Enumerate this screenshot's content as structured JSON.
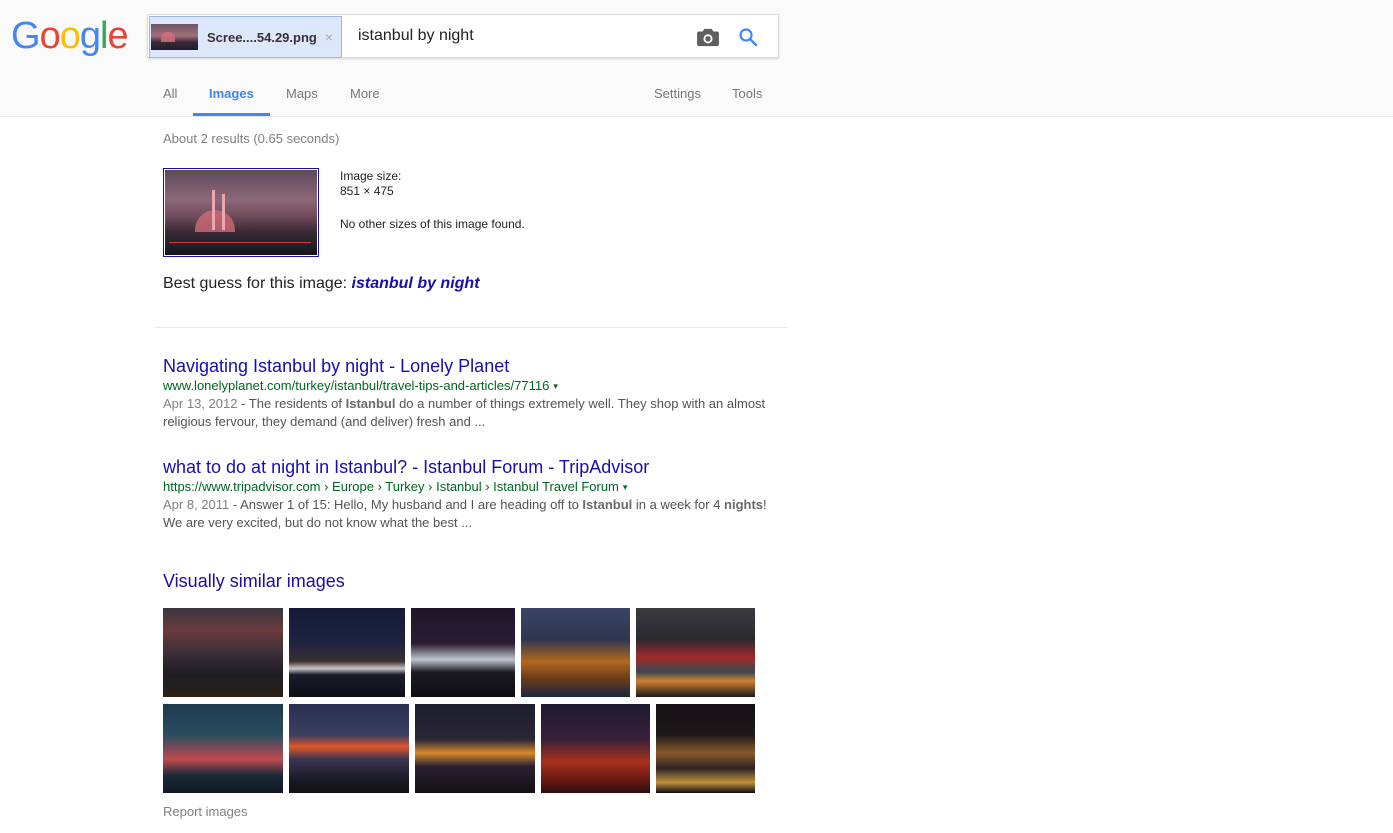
{
  "logo": {
    "letters": [
      "G",
      "o",
      "o",
      "g",
      "l",
      "e"
    ],
    "colors": [
      "#4285f4",
      "#ea4335",
      "#fbbc05",
      "#4285f4",
      "#34a853",
      "#ea4335"
    ]
  },
  "search": {
    "image_chip": {
      "filename": "Scree....54.29.png",
      "close_glyph": "×"
    },
    "query": "istanbul by night",
    "camera_icon": "camera-icon",
    "search_icon": "search-icon"
  },
  "tabs": [
    {
      "label": "All",
      "active": false
    },
    {
      "label": "Images",
      "active": true
    },
    {
      "label": "Maps",
      "active": false
    },
    {
      "label": "More",
      "active": false
    },
    {
      "label": "Settings",
      "active": false
    },
    {
      "label": "Tools",
      "active": false
    }
  ],
  "stats": "About 2 results (0.65 seconds)",
  "query_image": {
    "size_label": "Image size:",
    "size_value": "851 × 475",
    "other_sizes": "No other sizes of this image found."
  },
  "best_guess": {
    "prefix": "Best guess for this image: ",
    "link": "istanbul by night"
  },
  "results": [
    {
      "title": "Navigating Istanbul by night - Lonely Planet",
      "url": "www.lonelyplanet.com/turkey/istanbul/travel-tips-and-articles/77116",
      "date": "Apr 13, 2012",
      "snippet_parts": [
        " - The residents of ",
        "Istanbul",
        " do a number of things extremely well. They shop with an almost religious fervour, they demand (and deliver) fresh and ..."
      ]
    },
    {
      "title": "what to do at night in Istanbul? - Istanbul Forum - TripAdvisor",
      "url": "https://www.tripadvisor.com › Europe › Turkey › Istanbul › Istanbul Travel Forum",
      "date": "Apr 8, 2011",
      "snippet_parts": [
        " - Answer 1 of 15: Hello, My husband and I are heading off to ",
        "Istanbul",
        " in a week for 4 ",
        "nights",
        "! We are very excited, but do not know what the best ..."
      ]
    }
  ],
  "caret_glyph": "▾",
  "visually_similar": {
    "title": "Visually similar images",
    "images": [
      {
        "desc": "Mosque skyline at dusk with red sky"
      },
      {
        "desc": "Waterfront mosques and ferry terminal at night"
      },
      {
        "desc": "Ortakoy mosque lit at night"
      },
      {
        "desc": "Rumeli fortress illuminated"
      },
      {
        "desc": "Bosphorus bridge with red lights"
      },
      {
        "desc": "Ortakoy mosque and bridge at twilight"
      },
      {
        "desc": "Bridge and skyline with orange sunset"
      },
      {
        "desc": "Bosphorus bridge lit, aerial night view"
      },
      {
        "desc": "Blue mosque with red lighting"
      },
      {
        "desc": "Maiden's tower at night"
      }
    ]
  },
  "report": "Report images"
}
